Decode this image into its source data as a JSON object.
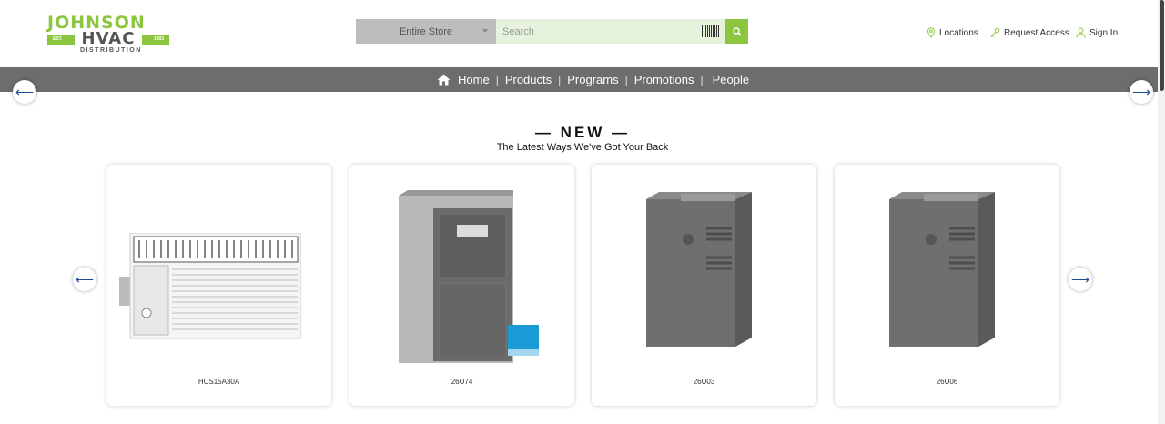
{
  "logo": {
    "top": "JOHNSON",
    "middle": "HVAC",
    "est_left": "EST.",
    "est_right": "1983",
    "sub": "DISTRIBUTION"
  },
  "search": {
    "scope": "Entire Store",
    "placeholder": "Search",
    "barcode_icon": "barcode-icon",
    "button_icon": "search-icon"
  },
  "utility": {
    "locations": "Locations",
    "request_access": "Request Access",
    "sign_in": "Sign In"
  },
  "nav": {
    "home": "Home",
    "products": "Products",
    "programs": "Programs",
    "promotions": "Promotions",
    "people": "People",
    "separator": "|"
  },
  "section": {
    "title": "— NEW —",
    "subtitle": "The Latest Ways We've Got Your Back"
  },
  "products": [
    {
      "label": "HCS15A30A"
    },
    {
      "label": "26U74"
    },
    {
      "label": "26U03"
    },
    {
      "label": "26U06"
    }
  ],
  "arrows": {
    "left": "⟵",
    "right": "⟶"
  },
  "colors": {
    "brand_green": "#8cc63f",
    "nav_gray": "#6d6d6d",
    "arrow_blue": "#1a4d8f"
  }
}
